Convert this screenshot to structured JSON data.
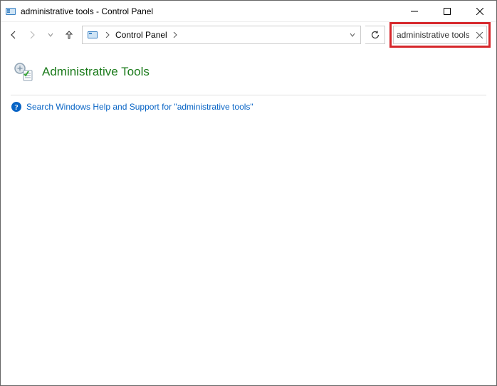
{
  "window": {
    "title": "administrative tools - Control Panel"
  },
  "breadcrumb": {
    "root": "Control Panel"
  },
  "search": {
    "value": "administrative tools"
  },
  "result": {
    "heading": "Administrative Tools"
  },
  "help": {
    "link_text": "Search Windows Help and Support for \"administrative tools\""
  }
}
